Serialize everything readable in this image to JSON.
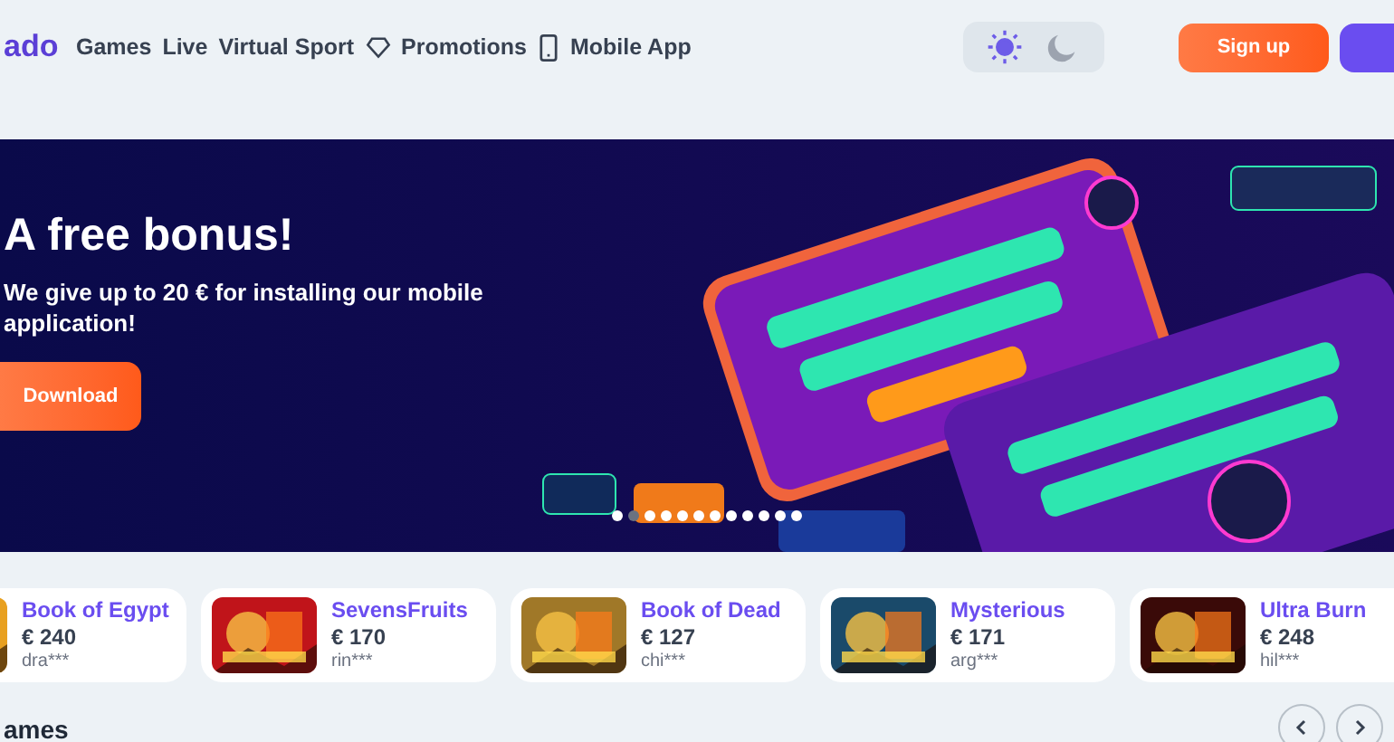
{
  "header": {
    "logo": "ado",
    "nav": [
      {
        "label": "Games",
        "kind": "text"
      },
      {
        "label": "Live",
        "kind": "text"
      },
      {
        "label": "Virtual Sport",
        "kind": "text"
      },
      {
        "label": "Promotions",
        "kind": "diamond"
      },
      {
        "label": "Mobile App",
        "kind": "phone"
      }
    ],
    "theme": [
      {
        "kind": "sun",
        "selected": true
      },
      {
        "kind": "moon",
        "selected": false
      }
    ],
    "signup": "Sign up"
  },
  "banner": {
    "title": "A free bonus!",
    "text": "We give up to 20 € for installing our mobile application!",
    "button": "Download",
    "dots": [
      {
        "selected": false
      },
      {
        "selected": true
      },
      {
        "selected": false
      },
      {
        "selected": false
      },
      {
        "selected": false
      },
      {
        "selected": false
      },
      {
        "selected": false
      },
      {
        "selected": false
      },
      {
        "selected": false
      },
      {
        "selected": false
      },
      {
        "selected": false
      },
      {
        "selected": false
      }
    ]
  },
  "wins": [
    {
      "game": "Book of Egypt",
      "amount": "€ 240",
      "user": "dra***"
    },
    {
      "game": "SevensFruits",
      "amount": "€ 170",
      "user": "rin***"
    },
    {
      "game": "Book of Dead",
      "amount": "€ 127",
      "user": "chi***"
    },
    {
      "game": "Mysterious",
      "amount": "€ 171",
      "user": "arg***"
    },
    {
      "game": "Ultra Burn",
      "amount": "€ 248",
      "user": "hil***"
    }
  ],
  "section": {
    "title": "ames"
  }
}
